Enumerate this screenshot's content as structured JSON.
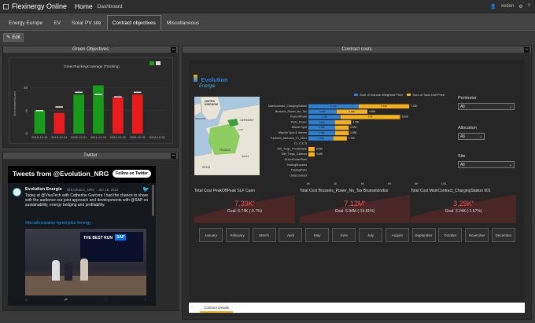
{
  "app": {
    "title": "Flexinergy Online",
    "home": "Home",
    "dashboard": "Dashboard",
    "user": "xeden"
  },
  "tabs": [
    {
      "label": "Energy Europe"
    },
    {
      "label": "EV"
    },
    {
      "label": "Solar PV site"
    },
    {
      "label": "Contract objectives",
      "active": true
    },
    {
      "label": "Miscellaneous"
    }
  ],
  "edit_label": "Edit",
  "green": {
    "header": "Green Objectives",
    "chart_title": "GreenTrackingCoverage (Tracking)",
    "ylabel": "GreenNetworkLabel"
  },
  "twitter": {
    "header": "Twitter",
    "tweets_title": "Tweets from @Evolution_NRG",
    "follow_label": "Follow on Twitter",
    "author": "Evolution Energie",
    "handle": "@Evolution_NRG · Jan 18, 2022",
    "text1": "Today at @VivaTech with Catherine Garcera I had the chance to share with the audience our joint approach and developments with @SAP on sustainability, energy hedging and profitability.",
    "hashtags": "#decarbonization #greenjobs #energy",
    "photo_sign": "THE BEST RUN",
    "photo_brand": "SAP"
  },
  "contract": {
    "header": "Contract costs",
    "logo_a": "Evolution",
    "logo_b": "Energie",
    "legend_a": "Sum of Volume Weighted Price",
    "legend_b": "Sum of Total Unit Price",
    "filters": [
      {
        "label": "Perimeter",
        "value": "All"
      },
      {
        "label": "Allocation",
        "value": "All"
      },
      {
        "label": "Site",
        "value": "All"
      }
    ],
    "map_labels": {
      "uk": "UNITED KINGDOM",
      "ie": "IRELAND",
      "de": "GERMANY",
      "fr": "FRANCE",
      "es": "SPAIN",
      "lu": "LUX",
      "ch": "SWITZ"
    },
    "gauges": [
      {
        "title": "Total Cost PeakOffPeak SLF Caen",
        "value": "7.39K",
        "unit": "€",
        "goal": "Goal: 6.74K (-9.7%)"
      },
      {
        "title": "Total Cost Brussels_Power_No_Tax BrusselsIndus",
        "value": "7.12M",
        "unit": "€",
        "goal": "Goal: 5.94M (-19.81%)"
      },
      {
        "title": "Total Cost MainContract_ChargingStation 001",
        "value": "3.29K",
        "unit": "€",
        "goal": "Goal: 3.24K (-1.67%)"
      }
    ],
    "months": [
      "January",
      "February",
      "March",
      "April",
      "May",
      "June",
      "July",
      "August",
      "September",
      "October",
      "November",
      "December"
    ],
    "bottom_tab": "Contract Details"
  },
  "colors": {
    "green": "#1a9a1a",
    "red": "#e81c1c",
    "blue": "#2f7fd1",
    "orange": "#f2b01e"
  },
  "chart_data": [
    {
      "type": "bar",
      "title": "GreenTrackingCoverage (Tracking)",
      "ylabel": "GreenNetworkLabel",
      "categories": [
        "2018-12-31",
        "2019-12-31",
        "2020-12-31",
        "2021-12-31",
        "2022-12-31",
        "2023-12-31",
        "2024-12-31"
      ],
      "series": [
        {
          "values": [
            5,
            4.5,
            8.5,
            10.5,
            8,
            8.5,
            null
          ]
        }
      ],
      "targets": [
        5,
        5.8,
        9,
        8.5,
        8,
        9,
        null
      ],
      "colors": [
        "green",
        "red",
        "green",
        "green",
        "red",
        "red"
      ],
      "yticks": [
        0,
        5,
        10
      ],
      "ylim": [
        0,
        13
      ]
    },
    {
      "type": "bar",
      "orientation": "horizontal",
      "categories": [
        "MainContract_ChargingStation",
        "Brussels_Power_No_Tax",
        "PeakOffPeak",
        "Paris_Power",
        "Market Spot",
        "Marché Spot & Interne",
        "Factures_Mesures_T1_2021",
        "C.L.C.C.S",
        "SSt_Turgo_ProdSolaire",
        "Sile_Turgo_Cabines",
        "GreenPowerPlant",
        "TradingBrussels",
        "TradingParis",
        "UnitsContract"
      ],
      "series": [
        {
          "name": "Sum of Volume Weighted Price",
          "values": [
            3.71,
            2.08,
            2.38,
            1.96,
            1.98,
            1.98,
            1.84,
            0,
            0,
            0,
            0,
            0,
            0,
            0
          ]
        },
        {
          "name": "Sum of Total Unit Price",
          "values": [
            3.74,
            2.28,
            4.4,
            1.2,
            1.0,
            1.0,
            1.0,
            0,
            0.46,
            0.46,
            0,
            0,
            0,
            0
          ]
        }
      ],
      "value_labels_a": [
        "3.71K",
        "2.08K",
        "2.38K",
        "1.96K",
        "1.98K",
        "1.98K",
        "1.84K",
        "",
        "",
        "",
        "",
        "",
        "",
        ""
      ],
      "value_labels_b": [
        "3.74K",
        "2.28K",
        "4.4K",
        "",
        "",
        "",
        "",
        "",
        "",
        "",
        "",
        "",
        "",
        ""
      ],
      "end_labels": [
        "7.43K",
        "4.88K",
        "6.63K",
        "3.16K",
        "2.94K",
        "2.83K",
        "1.75K",
        "",
        "0.46K",
        "0.46K",
        "",
        "",
        "",
        ""
      ],
      "xticks": [
        "0K",
        "2K",
        "4K",
        "6K",
        "8K",
        "10K"
      ],
      "xlim": [
        0,
        10
      ]
    }
  ]
}
